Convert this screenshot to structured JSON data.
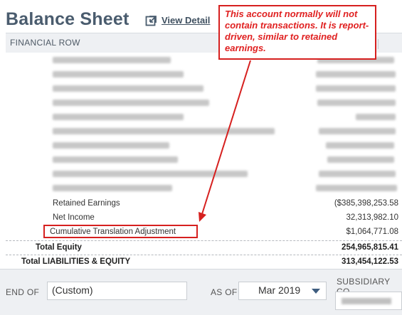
{
  "header": {
    "title": "Balance Sheet",
    "view_detail_label": "View Detail"
  },
  "table": {
    "column_financial_row": "FINANCIAL ROW",
    "rows": [
      {
        "label": "Retained Earnings",
        "amount": "($385,398,253.58"
      },
      {
        "label": "Net Income",
        "amount": "32,313,982.10"
      },
      {
        "label": "Cumulative Translation Adjustment",
        "amount": "$1,064,771.08"
      }
    ],
    "total_equity": {
      "label": "Total Equity",
      "amount": "254,965,815.41"
    },
    "total_liabilities_equity": {
      "label": "Total LIABILITIES & EQUITY",
      "amount": "313,454,122.53"
    }
  },
  "callout": {
    "text": "This account normally will not contain transactions. It is report-driven, similar to retained earnings.",
    "color": "#e02020"
  },
  "filters": {
    "end_of_label": "END OF",
    "end_of_value": "(Custom)",
    "as_of_label": "AS OF",
    "as_of_value": "Mar 2019",
    "subsidiary_label": "SUBSIDIARY CO"
  },
  "colors": {
    "title": "#4a5c6e",
    "highlight": "#d6201f",
    "footer_bg": "#eef0f3"
  },
  "icons": {
    "view_detail": "external-link-icon",
    "dropdown": "chevron-down-icon"
  }
}
